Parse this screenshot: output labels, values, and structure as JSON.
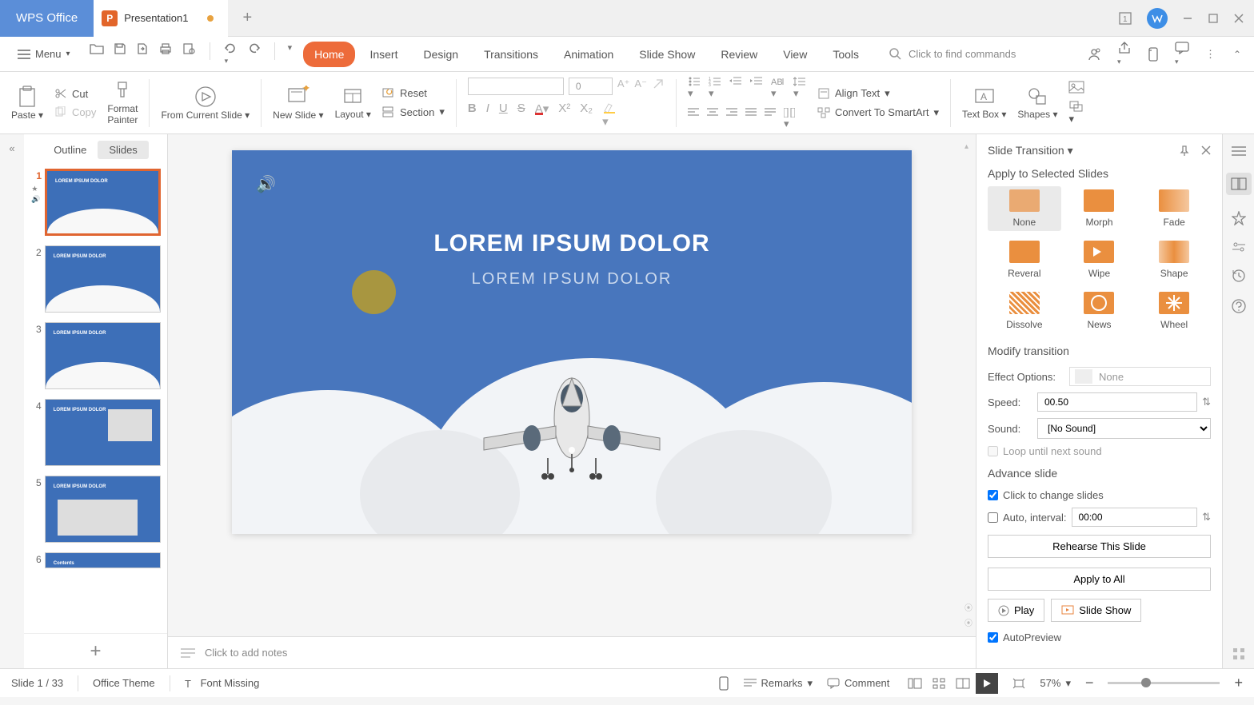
{
  "titlebar": {
    "app_name": "WPS Office",
    "doc_name": "Presentation1",
    "doc_icon_letter": "P"
  },
  "menu": {
    "menu_label": "Menu",
    "tabs": [
      "Home",
      "Insert",
      "Design",
      "Transitions",
      "Animation",
      "Slide Show",
      "Review",
      "View",
      "Tools"
    ],
    "active_tab": "Home",
    "search_placeholder": "Click to find commands"
  },
  "ribbon": {
    "paste": "Paste",
    "cut": "Cut",
    "copy": "Copy",
    "format_painter": "Format\nPainter",
    "from_current": "From Current Slide",
    "new_slide": "New Slide",
    "layout": "Layout",
    "reset": "Reset",
    "section": "Section",
    "font_size": "0",
    "align_text": "Align Text",
    "convert_smartart": "Convert To SmartArt",
    "text_box": "Text Box",
    "shapes": "Shapes"
  },
  "slide_panel": {
    "outline_tab": "Outline",
    "slides_tab": "Slides",
    "titles": [
      "LOREM IPSUM DOLOR",
      "LOREM IPSUM DOLOR",
      "LOREM IPSUM DOLOR",
      "LOREM IPSUM DOLOR",
      "LOREM IPSUM DOLOR",
      "Contents"
    ]
  },
  "canvas": {
    "title": "LOREM IPSUM DOLOR",
    "subtitle": "LOREM IPSUM DOLOR",
    "notes_placeholder": "Click to add notes"
  },
  "transition": {
    "pane_title": "Slide Transition",
    "apply_label": "Apply to Selected Slides",
    "items": [
      "None",
      "Morph",
      "Fade",
      "Reveral",
      "Wipe",
      "Shape",
      "Dissolve",
      "News",
      "Wheel"
    ],
    "selected": "None",
    "modify_label": "Modify transition",
    "effect_label": "Effect Options:",
    "effect_value": "None",
    "speed_label": "Speed:",
    "speed_value": "00.50",
    "sound_label": "Sound:",
    "sound_value": "[No Sound]",
    "loop_label": "Loop until next sound",
    "advance_label": "Advance slide",
    "click_label": "Click to change slides",
    "auto_label": "Auto, interval:",
    "auto_value": "00:00",
    "rehearse_btn": "Rehearse This Slide",
    "apply_all_btn": "Apply to All",
    "play_btn": "Play",
    "slideshow_btn": "Slide Show",
    "autopreview_label": "AutoPreview"
  },
  "status": {
    "slide_info": "Slide 1 / 33",
    "theme": "Office Theme",
    "font_missing": "Font Missing",
    "remarks": "Remarks",
    "comment": "Comment",
    "zoom": "57%"
  }
}
